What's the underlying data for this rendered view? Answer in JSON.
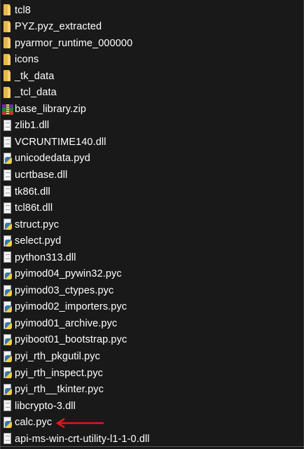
{
  "files": [
    {
      "name": "tcl8",
      "icon": "folder-icon"
    },
    {
      "name": "PYZ.pyz_extracted",
      "icon": "folder-icon"
    },
    {
      "name": "pyarmor_runtime_000000",
      "icon": "folder-icon"
    },
    {
      "name": "icons",
      "icon": "folder-icon"
    },
    {
      "name": "_tk_data",
      "icon": "folder-icon"
    },
    {
      "name": "_tcl_data",
      "icon": "folder-icon"
    },
    {
      "name": "base_library.zip",
      "icon": "zip-archive-icon"
    },
    {
      "name": "zlib1.dll",
      "icon": "dll-file-icon"
    },
    {
      "name": "VCRUNTIME140.dll",
      "icon": "dll-file-icon"
    },
    {
      "name": "unicodedata.pyd",
      "icon": "python-file-icon"
    },
    {
      "name": "ucrtbase.dll",
      "icon": "dll-file-icon"
    },
    {
      "name": "tk86t.dll",
      "icon": "dll-file-icon"
    },
    {
      "name": "tcl86t.dll",
      "icon": "dll-file-icon"
    },
    {
      "name": "struct.pyc",
      "icon": "python-file-icon"
    },
    {
      "name": "select.pyd",
      "icon": "python-file-icon"
    },
    {
      "name": "python313.dll",
      "icon": "dll-file-icon"
    },
    {
      "name": "pyimod04_pywin32.pyc",
      "icon": "python-file-icon"
    },
    {
      "name": "pyimod03_ctypes.pyc",
      "icon": "python-file-icon"
    },
    {
      "name": "pyimod02_importers.pyc",
      "icon": "python-file-icon"
    },
    {
      "name": "pyimod01_archive.pyc",
      "icon": "python-file-icon"
    },
    {
      "name": "pyiboot01_bootstrap.pyc",
      "icon": "python-file-icon"
    },
    {
      "name": "pyi_rth_pkgutil.pyc",
      "icon": "python-file-icon"
    },
    {
      "name": "pyi_rth_inspect.pyc",
      "icon": "python-file-icon"
    },
    {
      "name": "pyi_rth__tkinter.pyc",
      "icon": "python-file-icon"
    },
    {
      "name": "libcrypto-3.dll",
      "icon": "dll-file-icon"
    },
    {
      "name": "calc.pyc",
      "icon": "python-file-icon"
    },
    {
      "name": "api-ms-win-crt-utility-l1-1-0.dll",
      "icon": "dll-file-icon"
    }
  ],
  "annotation": {
    "arrow_color": "#e0191e",
    "points_to": "calc.pyc"
  },
  "colors": {
    "background": "#191919",
    "text": "#ffffff",
    "folder": "#e8b84a"
  }
}
